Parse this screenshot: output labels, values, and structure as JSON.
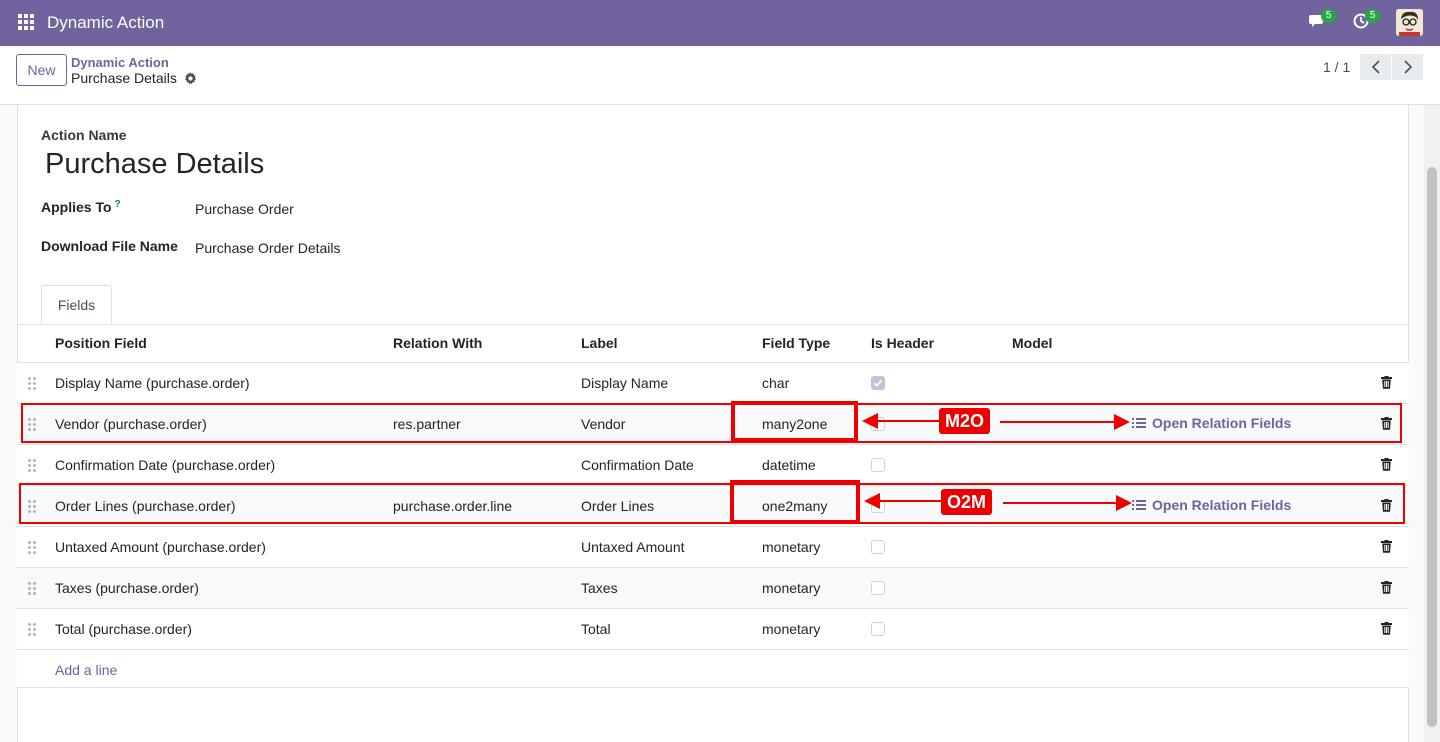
{
  "navbar": {
    "app_title": "Dynamic Action",
    "messages_badge": "5",
    "activities_badge": "5",
    "brand_color": "#71639e"
  },
  "control_panel": {
    "new_label": "New",
    "breadcrumb_parent": "Dynamic Action",
    "breadcrumb_current": "Purchase Details",
    "pager": "1 / 1"
  },
  "form": {
    "action_name_label": "Action Name",
    "action_name": "Purchase Details",
    "applies_to_label": "Applies To",
    "applies_to_help": "?",
    "applies_to": "Purchase Order",
    "download_label": "Download File Name",
    "download_value": "Purchase Order Details"
  },
  "tabs": [
    "Fields"
  ],
  "table": {
    "columns": [
      "Position Field",
      "Relation With",
      "Label",
      "Field Type",
      "Is Header",
      "Model"
    ],
    "rows": [
      {
        "position": "Display Name (purchase.order)",
        "relation": "",
        "label": "Display Name",
        "type": "char",
        "header": true,
        "model": ""
      },
      {
        "position": "Vendor (purchase.order)",
        "relation": "res.partner",
        "label": "Vendor",
        "type": "many2one",
        "header": false,
        "model": "Open Relation Fields"
      },
      {
        "position": "Confirmation Date (purchase.order)",
        "relation": "",
        "label": "Confirmation Date",
        "type": "datetime",
        "header": false,
        "model": ""
      },
      {
        "position": "Order Lines (purchase.order)",
        "relation": "purchase.order.line",
        "label": "Order Lines",
        "type": "one2many",
        "header": false,
        "model": "Open Relation Fields"
      },
      {
        "position": "Untaxed Amount (purchase.order)",
        "relation": "",
        "label": "Untaxed Amount",
        "type": "monetary",
        "header": false,
        "model": ""
      },
      {
        "position": "Taxes (purchase.order)",
        "relation": "",
        "label": "Taxes",
        "type": "monetary",
        "header": false,
        "model": ""
      },
      {
        "position": "Total (purchase.order)",
        "relation": "",
        "label": "Total",
        "type": "monetary",
        "header": false,
        "model": ""
      }
    ],
    "add_line": "Add a line"
  },
  "annotations": {
    "m2o_tag": "M2O",
    "o2m_tag": "O2M",
    "color": "#ee0000"
  }
}
